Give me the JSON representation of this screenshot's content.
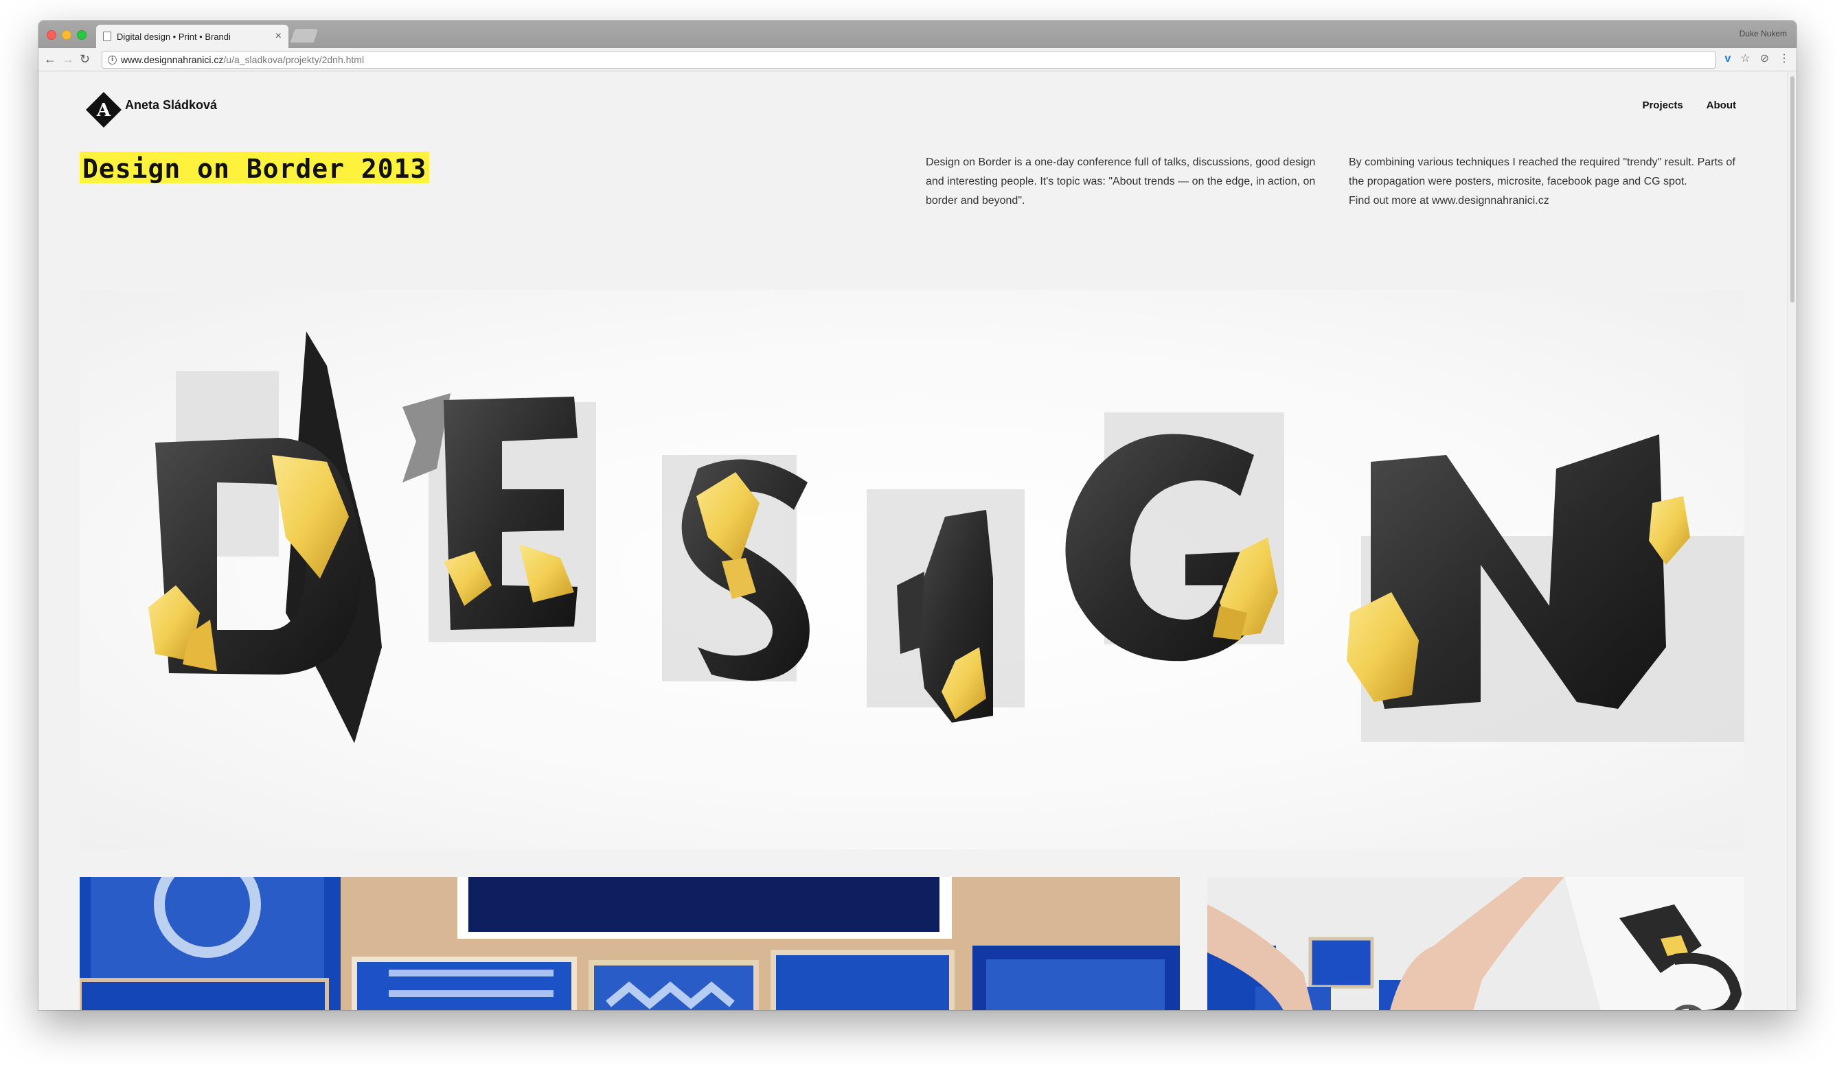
{
  "browser": {
    "tab_title": "Digital design • Print • Brandi",
    "tab_close": "×",
    "profile_name": "Duke Nukem",
    "url_host": "www.designnahranici.cz",
    "url_path": "/u/a_sladkova/projekty/2dnh.html",
    "icons": [
      "back-icon",
      "forward-icon",
      "reload-icon",
      "info-icon",
      "vimeo-extension-icon",
      "star-icon",
      "extension-icon",
      "menu-icon"
    ]
  },
  "site": {
    "logo_letter": "A",
    "name": "Aneta Sládková",
    "nav": [
      "Projects",
      "About"
    ]
  },
  "project": {
    "title": "Design on Border 2013",
    "description": "Design on Border is a one-day conference full of talks, discussions, good design and interesting people. It's topic was: \"About trends — on the edge, in action, on border and beyond\".",
    "details_line1": "By combining various techniques I reached the required \"trendy\" result. Parts of the propagation were posters, microsite, facebook page and CG spot.",
    "details_line2": "Find out more at www.designnahranici.cz"
  },
  "hero": {
    "letters": [
      "D",
      "E",
      "S",
      "I",
      "G",
      "N"
    ]
  },
  "colors": {
    "accent_yellow": "#fff23c",
    "gold": "#f2cf52",
    "letter_black": "#2c2c2c",
    "stamp_blue": "#1546b8"
  }
}
